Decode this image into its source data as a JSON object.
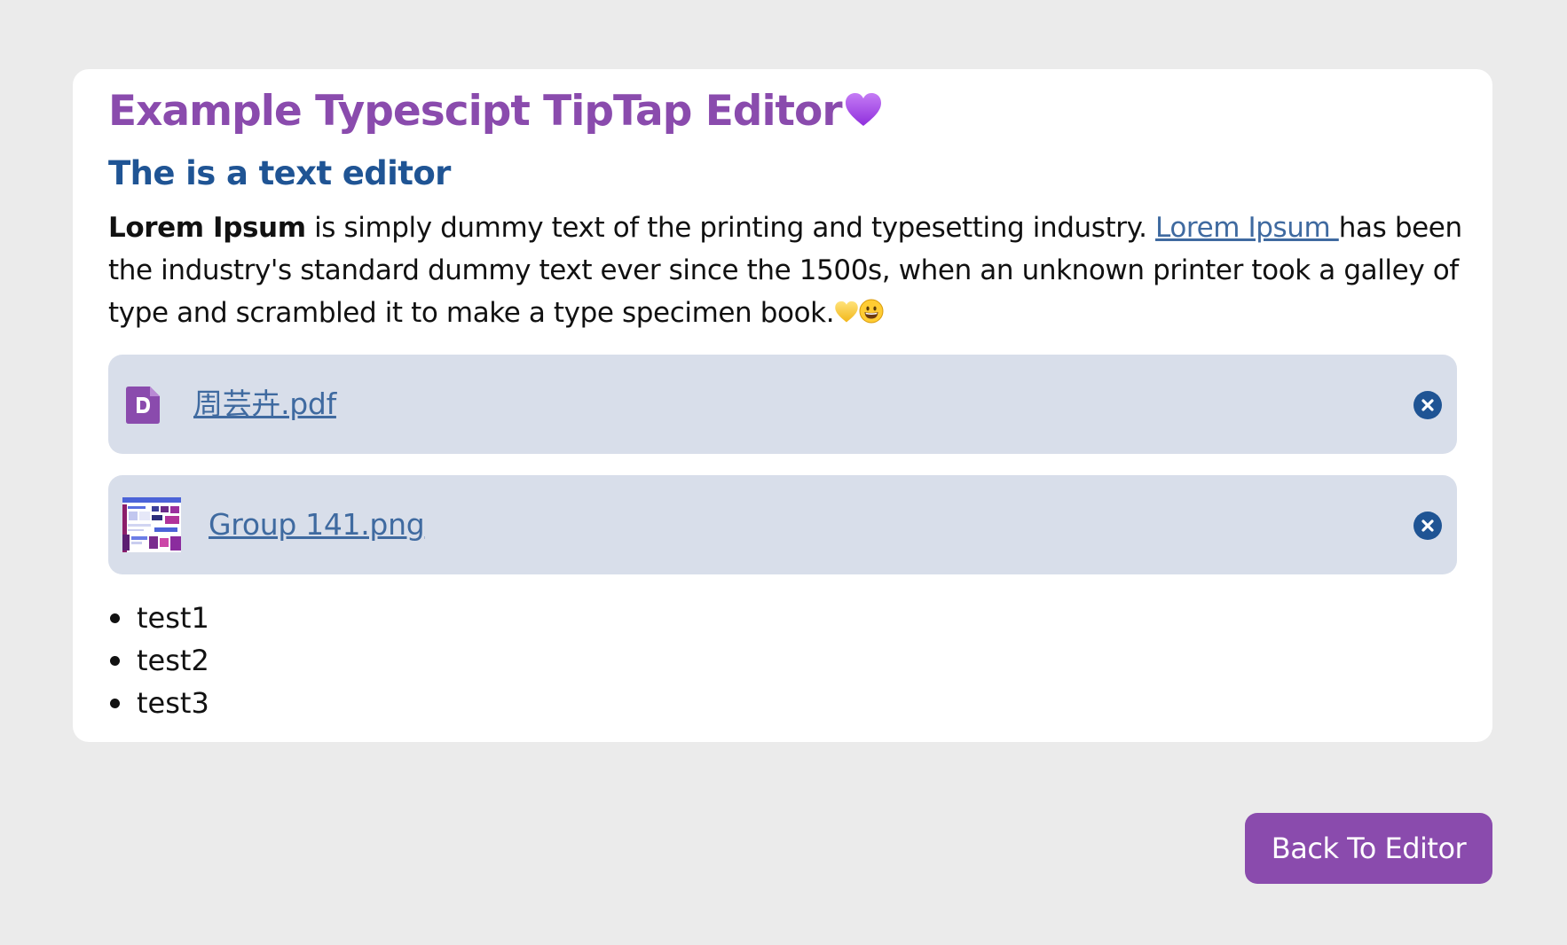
{
  "editor": {
    "title": "Example Typescipt TipTap Editor",
    "title_emoji": "purple-heart",
    "subtitle": "The is a text editor",
    "paragraph": {
      "bold_text": "Lorem Ipsum",
      "text_before_link": " is simply dummy text of the printing and typesetting industry. ",
      "link_text": "Lorem Ipsum ",
      "text_after_link": "has been the industry's standard dummy text ever since the 1500s, when an unknown printer took a galley of type and scrambled it to make a type specimen book.",
      "trailing_emojis": [
        "yellow-heart",
        "grinning-face"
      ]
    },
    "attachments": [
      {
        "name": "周芸卉.pdf",
        "icon": "pdf-file-icon",
        "accent": "#8a4bad"
      },
      {
        "name": "Group 141.png",
        "icon": "image-thumbnail"
      }
    ],
    "list": [
      "test1",
      "test2",
      "test3"
    ]
  },
  "footer": {
    "back_button_label": "Back To Editor"
  },
  "colors": {
    "background": "#ebebeb",
    "card": "#ffffff",
    "title": "#8a4bad",
    "subtitle": "#1f5494",
    "link": "#3f6aa0",
    "attachment_bg": "#d8deea",
    "remove_icon": "#1f5494",
    "button": "#8a4bad"
  }
}
